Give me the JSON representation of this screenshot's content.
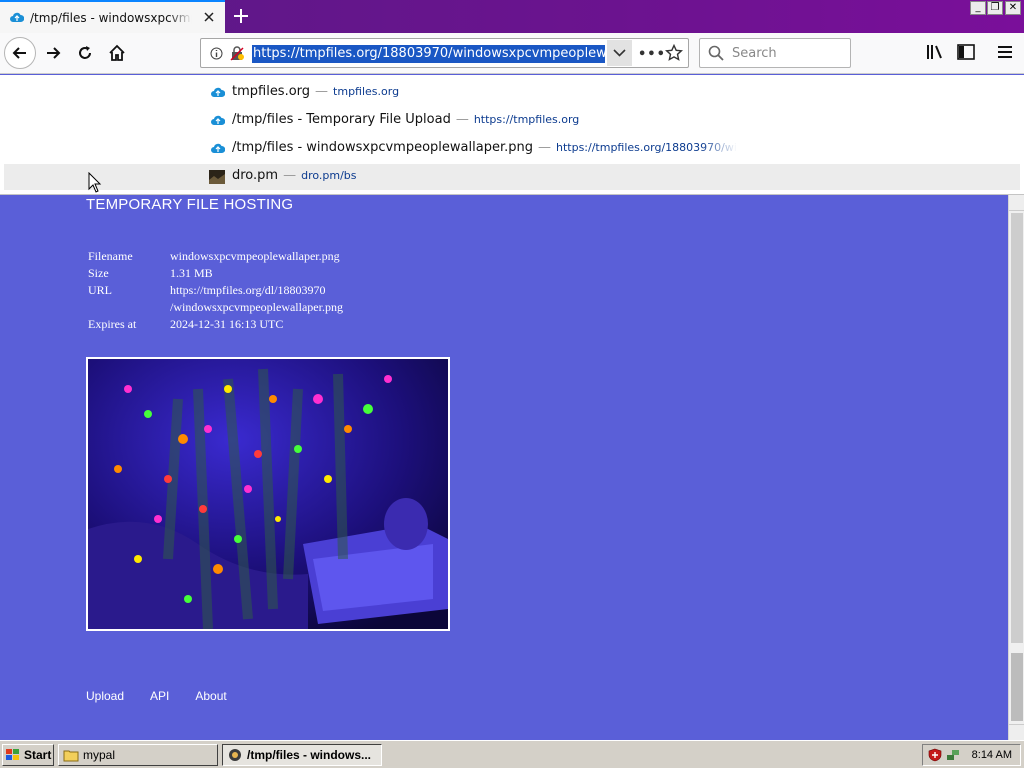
{
  "browser": {
    "tab": {
      "title": "/tmp/files - windowsxpcvmpeoplewallaper.png"
    },
    "window_controls": {
      "minimize": "_",
      "restore": "❐",
      "close": "✕"
    },
    "url": "https://tmpfiles.org/18803970/windowsxpcvmpeoplewallaper.png",
    "search_placeholder": "Search",
    "more_label": "•••"
  },
  "autocomplete": [
    {
      "title": "tmpfiles.org",
      "sep": "—",
      "url": "tmpfiles.org",
      "icon": "cloud-icon"
    },
    {
      "title": "/tmp/files - Temporary File Upload",
      "sep": "—",
      "url": "https://tmpfiles.org",
      "icon": "cloud-icon"
    },
    {
      "title": "/tmp/files - windowsxpcvmpeoplewallaper.png",
      "sep": "—",
      "url": "https://tmpfiles.org/18803970/wi",
      "icon": "cloud-icon"
    },
    {
      "title": "dro.pm",
      "sep": "—",
      "url": "dro.pm/bs",
      "icon": "site-thumbnail-icon"
    }
  ],
  "page": {
    "heading": "TEMPORARY FILE HOSTING",
    "meta": [
      {
        "label": "Filename",
        "value": "windowsxpcvmpeoplewallaper.png"
      },
      {
        "label": "Size",
        "value": "1.31 MB"
      },
      {
        "label": "URL",
        "value": "https://tmpfiles.org/dl/18803970 /windowsxpcvmpeoplewallaper.png"
      },
      {
        "label": "Expires at",
        "value": "2024-12-31 16:13 UTC"
      }
    ],
    "footer_links": [
      "Upload",
      "API",
      "About"
    ],
    "background_color": "#5a5fd8"
  },
  "taskbar": {
    "start_label": "Start",
    "buttons": [
      {
        "label": "mypal",
        "icon": "folder-icon"
      },
      {
        "label": "/tmp/files - windows...",
        "icon": "browser-icon"
      }
    ],
    "clock": "8:14 AM"
  }
}
